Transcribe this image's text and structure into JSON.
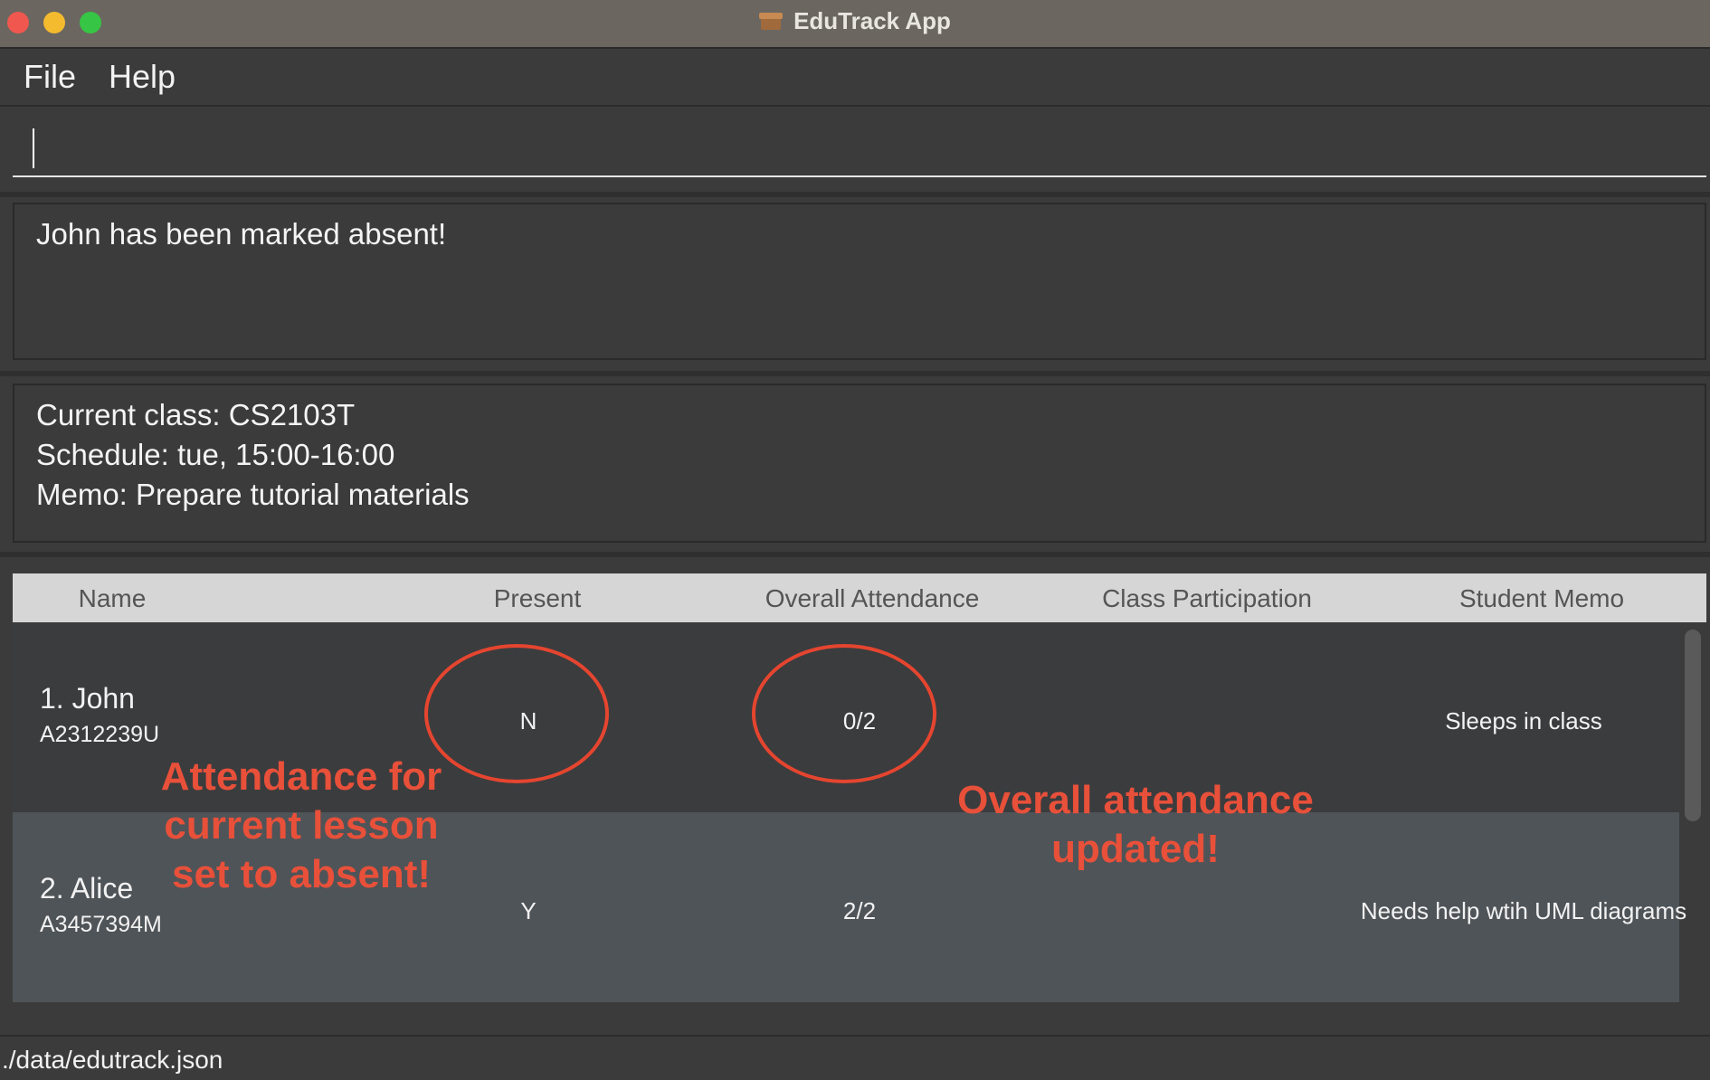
{
  "window": {
    "title": "EduTrack App"
  },
  "menu": {
    "file": "File",
    "help": "Help"
  },
  "command": {
    "value": ""
  },
  "result": {
    "message": "John has been marked absent!"
  },
  "class_info": {
    "current_class": "Current class: CS2103T",
    "schedule": "Schedule: tue, 15:00-16:00",
    "memo": "Memo: Prepare tutorial materials"
  },
  "table": {
    "headers": [
      "Name",
      "Present",
      "Overall Attendance",
      "Class Participation",
      "Student Memo"
    ],
    "rows": [
      {
        "name": "1.  John",
        "id": "A2312239U",
        "present": "N",
        "overall": "0/2",
        "participation": "",
        "memo": "Sleeps in class"
      },
      {
        "name": "2.  Alice",
        "id": "A3457394M",
        "present": "Y",
        "overall": "2/2",
        "participation": "",
        "memo": "Needs help wtih UML diagrams"
      }
    ]
  },
  "annotations": {
    "left": [
      "Attendance for",
      "current lesson",
      "set to absent!"
    ],
    "right": [
      "Overall attendance",
      "updated!"
    ],
    "color": "#e8503a"
  },
  "status": {
    "path": "./data/edutrack.json"
  },
  "colors": {
    "titlebar": "#6b6660",
    "background": "#3b3b3b",
    "header": "#d6d6d6",
    "row_alt": "#4f5458"
  }
}
